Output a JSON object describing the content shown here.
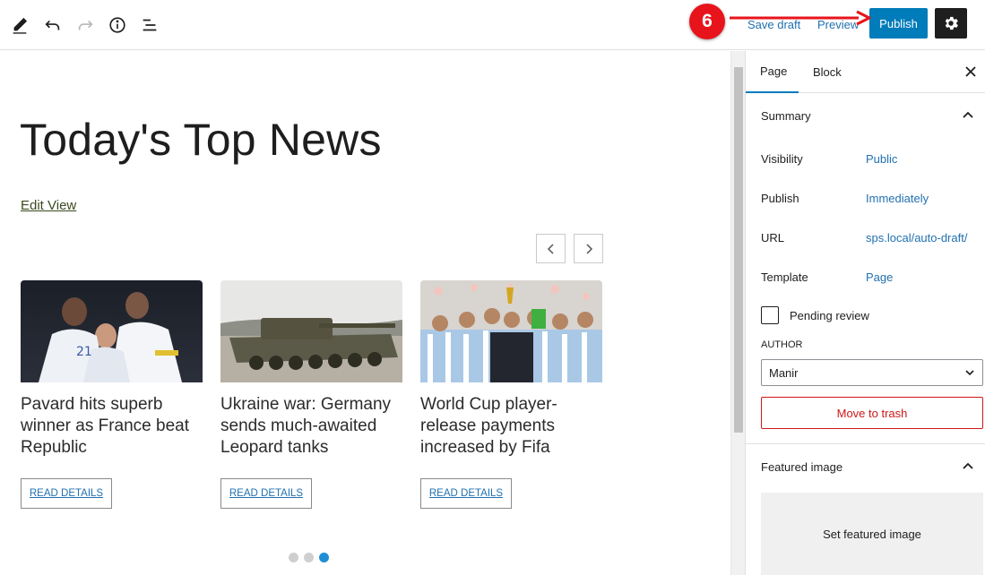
{
  "toolbar": {
    "save_draft": "Save draft",
    "preview": "Preview",
    "publish": "Publish",
    "icons": [
      "pencil-icon",
      "undo-icon",
      "redo-icon",
      "info-icon",
      "list-view-icon",
      "gear-icon"
    ]
  },
  "annotation": {
    "step_number": "6",
    "color": "#e8141c"
  },
  "editor": {
    "title": "Today's Top News",
    "edit_view": "Edit View",
    "cards": [
      {
        "title": "Pavard hits superb winner as France beat Republic",
        "button": "READ DETAILS"
      },
      {
        "title": "Ukraine war: Germany sends much-awaited Leopard tanks",
        "button": "READ DETAILS"
      },
      {
        "title": "World Cup player-release payments increased by Fifa",
        "button": "READ DETAILS"
      }
    ],
    "slider_dots": 3,
    "active_dot": 3
  },
  "sidebar": {
    "tabs": [
      {
        "label": "Page",
        "active": true
      },
      {
        "label": "Block",
        "active": false
      }
    ],
    "summary": {
      "heading": "Summary",
      "rows": [
        {
          "label": "Visibility",
          "value": "Public"
        },
        {
          "label": "Publish",
          "value": "Immediately"
        },
        {
          "label": "URL",
          "value": "sps.local/auto-draft/"
        },
        {
          "label": "Template",
          "value": "Page"
        }
      ],
      "pending_review": "Pending review",
      "author_label": "AUTHOR",
      "author_value": "Manir",
      "move_to_trash": "Move to trash"
    },
    "featured_image": {
      "heading": "Featured image",
      "set_label": "Set featured image"
    }
  },
  "colors": {
    "accent": "#007cba",
    "link": "#2271b1",
    "danger": "#cc1818",
    "dark": "#1e1e1e"
  }
}
